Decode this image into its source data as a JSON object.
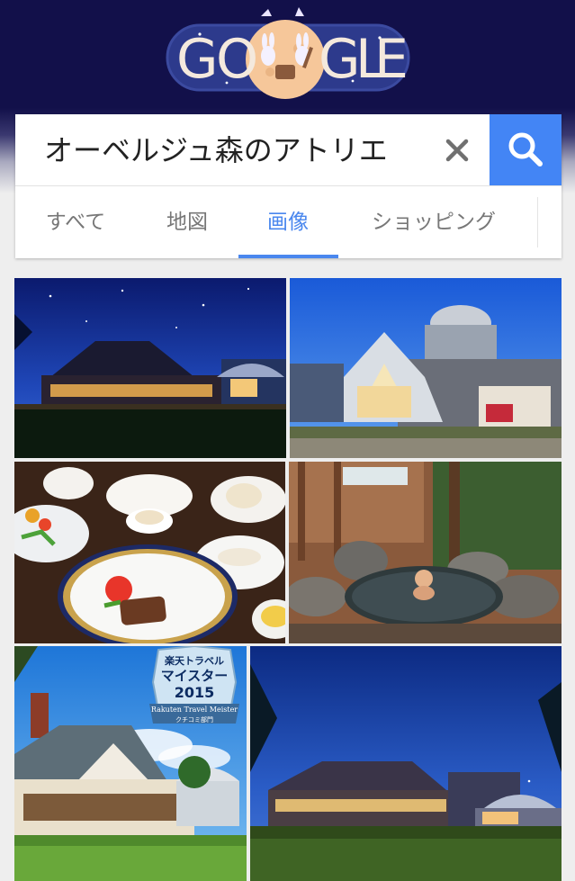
{
  "doodle": {
    "letters": [
      "G",
      "O",
      "G",
      "L",
      "E"
    ],
    "colors": {
      "bg": "#12104a",
      "moon": "#f6c79a",
      "letters": "#f4e9dd"
    }
  },
  "search": {
    "query": "オーベルジュ森のアトリエ",
    "clear_icon": "close-icon",
    "submit_icon": "search-icon",
    "accent": "#4385f5"
  },
  "tabs": {
    "items": [
      {
        "label": "すべて",
        "active": false
      },
      {
        "label": "地図",
        "active": false
      },
      {
        "label": "画像",
        "active": true
      },
      {
        "label": "ショッピング",
        "active": false
      }
    ],
    "active_color": "#4a87ee"
  },
  "results": {
    "images": [
      {
        "scene": "hotel exterior at night under starry sky"
      },
      {
        "scene": "glass dome building with observatory under blue sky"
      },
      {
        "scene": "French course dinner plates with steak"
      },
      {
        "scene": "rocky open-air hot spring bath in wooden hut"
      },
      {
        "scene": "chalet in daytime with award badge",
        "badge": {
          "line1": "楽天トラベル",
          "line2": "マイスター",
          "line3": "2015",
          "line4": "Rakuten Travel Meister",
          "line5": "クチコミ部門"
        }
      },
      {
        "scene": "chalet and lawn at dusk"
      }
    ]
  }
}
